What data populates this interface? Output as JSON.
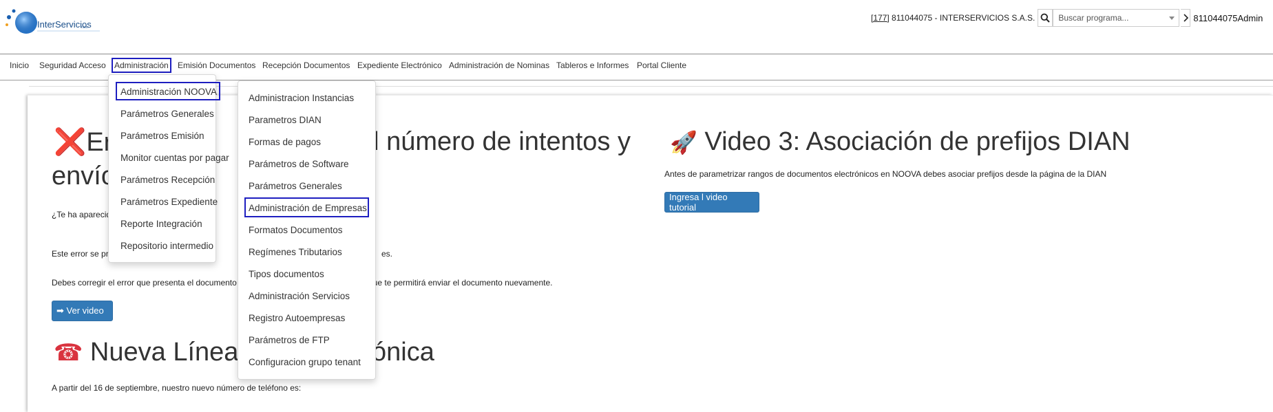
{
  "header": {
    "logo_text": "InterServicios",
    "logo_suffix": "s.a.s.",
    "company_code": "[177]",
    "company_rest": " 811044075 - INTERSERVICIOS S.A.S.",
    "search_placeholder": "Buscar programa...",
    "user": "811044075Admin"
  },
  "nav": {
    "items": [
      "Inicio",
      "Seguridad Acceso",
      "Administración",
      "Emisión Documentos",
      "Recepción Documentos",
      "Expediente Electrónico",
      "Administración de Nominas",
      "Tableros e Informes",
      "Portal Cliente"
    ]
  },
  "content": {
    "error_icon": "❌",
    "heading1_start": "Er",
    "heading1_end": "ado el número de intentos y",
    "heading1_line2": "envíos",
    "para1": "¿Te ha aparecid",
    "para2_start": "Este error se pre",
    "para2_end": "es.",
    "para3_start": "Debes corregir el error que presenta el documento y",
    "para3_end": "que te permitirá enviar el documento nuevamente.",
    "ver_video": "➡ Ver video",
    "phone_icon": "☎",
    "heading2_start": "Nueva Línea de",
    "heading2_end": "ónica",
    "para4": "A partir del 16 de septiembre, nuestro nuevo número de teléfono es:",
    "rocket_icon": "🚀",
    "heading3": "Video 3: Asociación de prefijos DIAN",
    "para5": "Antes de parametrizar rangos de documentos electrónicos en NOOVA debes asociar prefijos desde la página de la DIAN",
    "tutorial_button": "Ingresa l video tutorial"
  },
  "admin_menu": {
    "items": [
      "Administración NOOVA",
      "Parámetros Generales",
      "Parámetros Emisión",
      "Monitor cuentas por pagar",
      "Parámetros Recepción",
      "Parámetros Expediente",
      "Reporte Integración",
      "Repositorio intermedio"
    ]
  },
  "noova_submenu": {
    "items": [
      "Administracion Instancias",
      "Parametros DIAN",
      "Formas de pagos",
      "Parámetros de Software",
      "Parámetros Generales",
      "Administración de Empresas",
      "Formatos Documentos",
      "Regímenes Tributarios",
      "Tipos documentos",
      "Administración Servicios",
      "Registro Autoempresas",
      "Parámetros de FTP",
      "Configuracion grupo tenant"
    ]
  }
}
